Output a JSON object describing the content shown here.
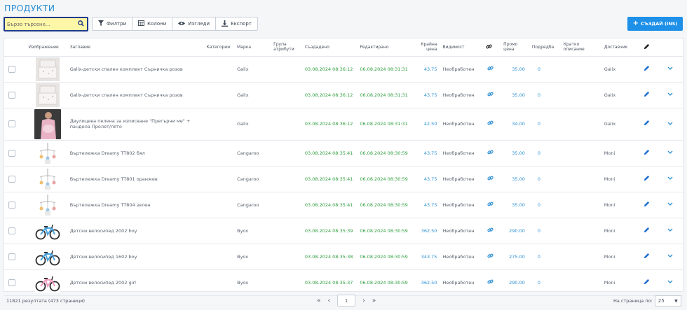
{
  "page_title": "ПРОДУКТИ",
  "search": {
    "placeholder": "Бързо търсене...",
    "icon": "search-icon"
  },
  "toolbar": {
    "filters": "Филтри",
    "columns": "Колони",
    "views": "Изгледи",
    "export": "Експорт"
  },
  "create_button": "СЪЗДАЙ (INS)",
  "columns": [
    "",
    "Изображение",
    "Заглавие",
    "Категории",
    "Марка",
    "Група атрибути",
    "Създадено",
    "Редактирано",
    "Крайна цена",
    "Видимост",
    "",
    "Промо цена",
    "Подредба",
    "Кратко описание",
    "Доставчик",
    "",
    ""
  ],
  "rows": [
    {
      "image": "bedding",
      "title": "Galix-детски спален комплект Сърничка розов",
      "brand": "Galix",
      "created": "03.08.2024 08:36:12",
      "edited": "06.08.2024 08:31:31",
      "price": "43.75",
      "visibility": "Необработен",
      "promo": "35.00",
      "order": "0",
      "supplier": "Galix"
    },
    {
      "image": "bedding",
      "title": "Galix-детски спален комплект Сърничка розов",
      "brand": "Galix",
      "created": "03.08.2024 08:36:12",
      "edited": "06.08.2024 08:31:31",
      "price": "43.75",
      "visibility": "Необработен",
      "promo": "35.00",
      "order": "0",
      "supplier": "Galix"
    },
    {
      "image": "person",
      "title": "Двулицева пелена за изписване \"Прегърни ме\" + пандела Пролет/лято",
      "brand": "Galix",
      "created": "03.08.2024 08:36:12",
      "edited": "06.08.2024 08:31:31",
      "price": "42.50",
      "visibility": "Необработен",
      "promo": "34.00",
      "order": "0",
      "supplier": "Galix"
    },
    {
      "image": "mobile",
      "title": "Въртележка Dreamy TT802 бял",
      "brand": "Cangaroo",
      "created": "03.08.2024 08:35:41",
      "edited": "06.08.2024 08:30:59",
      "price": "43.75",
      "visibility": "Необработен",
      "promo": "35.00",
      "order": "0",
      "supplier": "Moni"
    },
    {
      "image": "mobile",
      "title": "Въртележка Dreamy TT801 оранжев",
      "brand": "Cangaroo",
      "created": "03.08.2024 08:35:41",
      "edited": "06.08.2024 08:30:59",
      "price": "43.75",
      "visibility": "Необработен",
      "promo": "35.00",
      "order": "0",
      "supplier": "Moni"
    },
    {
      "image": "mobile",
      "title": "Въртележка Dreamy TT804 зелен",
      "brand": "Cangaroo",
      "created": "03.08.2024 08:35:41",
      "edited": "06.08.2024 08:30:59",
      "price": "43.75",
      "visibility": "Необработен",
      "promo": "35.00",
      "order": "0",
      "supplier": "Moni"
    },
    {
      "image": "bike-blue",
      "title": "Детски велосипед 2002 boy",
      "brand": "Byox",
      "created": "03.08.2024 08:35:39",
      "edited": "06.08.2024 08:30:59",
      "price": "362.50",
      "visibility": "Необработен",
      "promo": "290.00",
      "order": "0",
      "supplier": "Moni"
    },
    {
      "image": "bike-blue",
      "title": "Детски велосипед 1602 boy",
      "brand": "Byox",
      "created": "03.08.2024 08:35:38",
      "edited": "06.08.2024 08:30:59",
      "price": "343.75",
      "visibility": "Необработен",
      "promo": "275.00",
      "order": "0",
      "supplier": "Moni"
    },
    {
      "image": "bike-pink",
      "title": "Детски велосипед 2002 girl",
      "brand": "Byox",
      "created": "03.08.2024 08:35:37",
      "edited": "06.08.2024 08:30:59",
      "price": "362.50",
      "visibility": "Необработен",
      "promo": "290.00",
      "order": "0",
      "supplier": "Moni"
    }
  ],
  "footer": {
    "results": "11821 резултата (473 страници)",
    "page": "1",
    "per_page_label": "На страница по:",
    "per_page_value": "25"
  },
  "colors": {
    "accent": "#2d8fd4",
    "green": "#2f9e3f",
    "search_bg": "#fff7a8",
    "button": "#1e90e8"
  }
}
